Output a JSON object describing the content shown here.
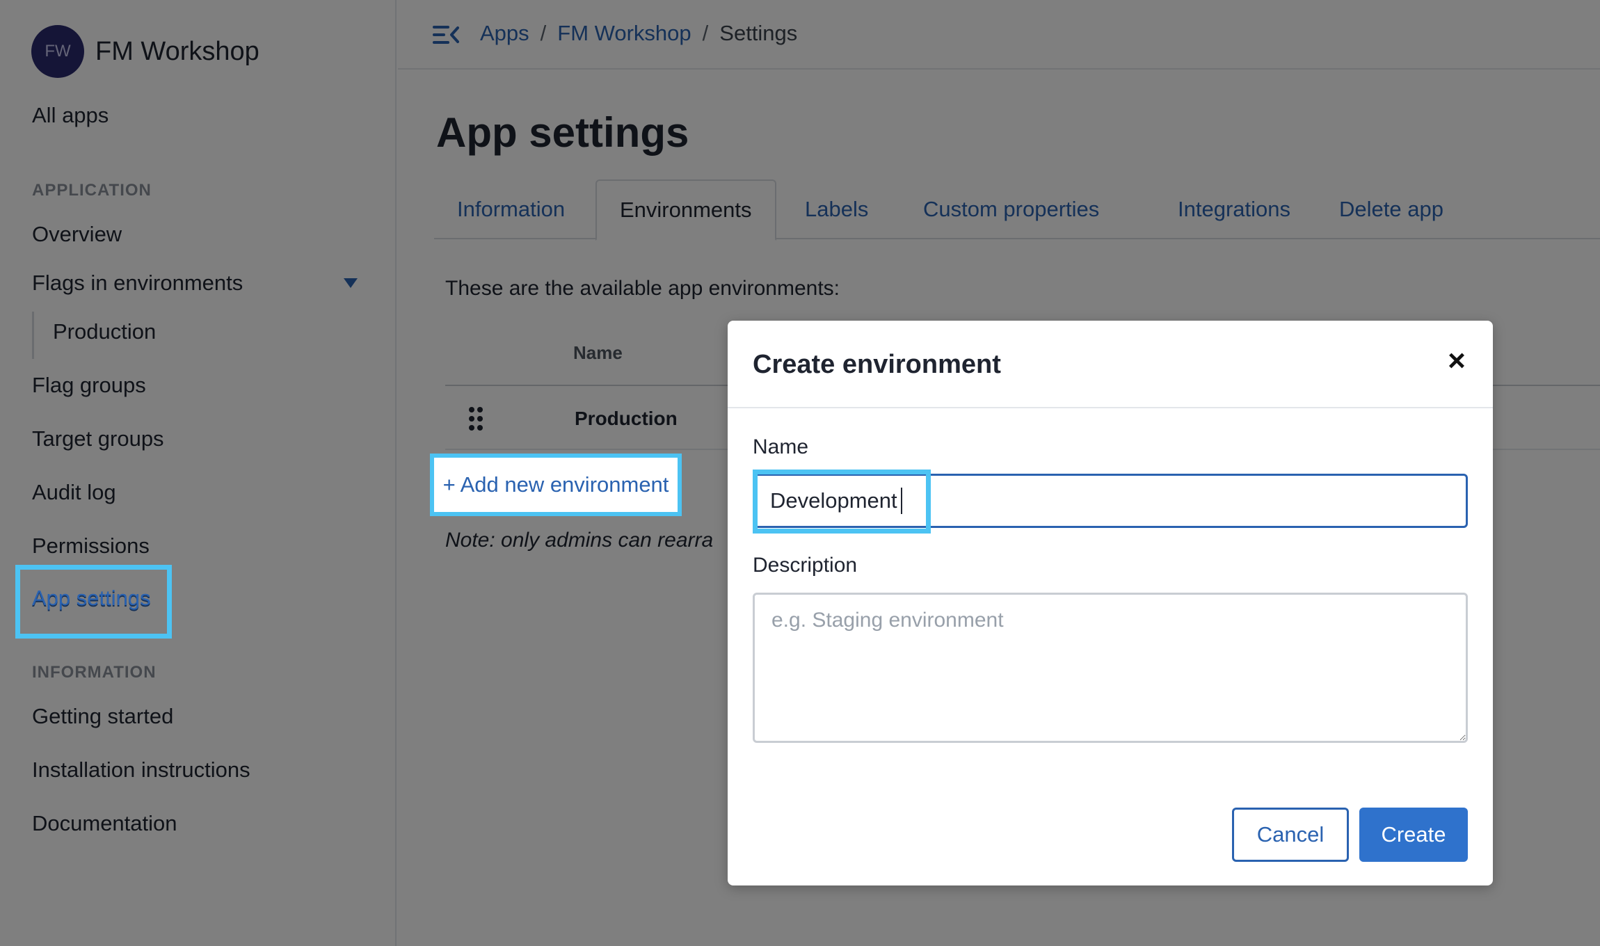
{
  "brand": {
    "initials": "FW",
    "name": "FM Workshop"
  },
  "sidebar": {
    "all_apps": "All apps",
    "section_application": "APPLICATION",
    "overview": "Overview",
    "flags_in_environments": "Flags in environments",
    "production": "Production",
    "flag_groups": "Flag groups",
    "target_groups": "Target groups",
    "audit_log": "Audit log",
    "permissions": "Permissions",
    "app_settings": "App settings",
    "section_information": "INFORMATION",
    "getting_started": "Getting started",
    "installation_instructions": "Installation instructions",
    "documentation": "Documentation"
  },
  "breadcrumb": {
    "apps": "Apps",
    "sep": "/",
    "workshop": "FM Workshop",
    "current": "Settings"
  },
  "page": {
    "title": "App settings",
    "tabs": {
      "information": "Information",
      "environments": "Environments",
      "labels": "Labels",
      "custom_properties": "Custom properties",
      "integrations": "Integrations",
      "delete_app": "Delete app"
    },
    "intro": "These are the available app environments:",
    "table_header_name": "Name",
    "row_name": "Production",
    "add_environment": "+ Add new environment",
    "note": "Note: only admins can rearra"
  },
  "modal": {
    "title": "Create environment",
    "close": "×",
    "name_label": "Name",
    "name_value": "Development",
    "description_label": "Description",
    "description_placeholder": "e.g. Staging environment",
    "cancel": "Cancel",
    "create": "Create"
  },
  "colors": {
    "link": "#2a62b0",
    "primary": "#2f72cc",
    "highlight": "#4cc3f3",
    "avatar": "#2b2a6e"
  }
}
